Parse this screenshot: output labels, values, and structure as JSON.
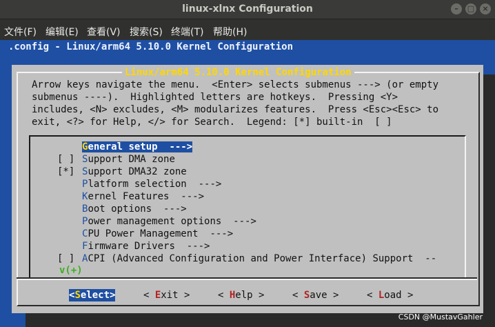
{
  "window": {
    "title": "linux-xlnx Configuration",
    "min_glyph": "–",
    "max_glyph": "□",
    "close_glyph": "×"
  },
  "menubar": [
    {
      "label": "文件(F)"
    },
    {
      "label": "编辑(E)"
    },
    {
      "label": "查看(V)"
    },
    {
      "label": "搜索(S)"
    },
    {
      "label": "终端(T)"
    },
    {
      "label": "帮助(H)"
    }
  ],
  "terminal": {
    "headline": ".config - Linux/arm64 5.10.0 Kernel Configuration"
  },
  "dialog": {
    "title": "Linux/arm64 5.10.0 Kernel Configuration",
    "help_lines": [
      "Arrow keys navigate the menu.  <Enter> selects submenus ---> (or empty",
      "submenus ----).  Highlighted letters are hotkeys.  Pressing <Y>",
      "includes, <N> excludes, <M> modularizes features.  Press <Esc><Esc> to",
      "exit, <?> for Help, </> for Search.  Legend: [*] built-in  [ ]"
    ],
    "items": [
      {
        "prefix": "",
        "hotkey": "G",
        "rest": "eneral setup  --->"
      },
      {
        "prefix": "[ ]",
        "hotkey": "S",
        "rest": "upport DMA zone"
      },
      {
        "prefix": "[*]",
        "hotkey": "S",
        "rest": "upport DMA32 zone"
      },
      {
        "prefix": "",
        "hotkey": "P",
        "rest": "latform selection  --->"
      },
      {
        "prefix": "",
        "hotkey": "K",
        "rest": "ernel Features  --->"
      },
      {
        "prefix": "",
        "hotkey": "B",
        "rest": "oot options  --->"
      },
      {
        "prefix": "",
        "hotkey": "P",
        "rest": "ower management options  --->"
      },
      {
        "prefix": "",
        "hotkey": "C",
        "rest": "PU Power Management  --->"
      },
      {
        "prefix": "",
        "hotkey": "F",
        "rest": "irmware Drivers  --->"
      },
      {
        "prefix": "[ ]",
        "hotkey": "A",
        "rest": "CPI (Advanced Configuration and Power Interface) Support  --"
      }
    ],
    "more_indicator": "v(+)",
    "buttons": [
      {
        "open": "<",
        "hotkey": "S",
        "rest": "elect",
        "close": ">"
      },
      {
        "open": "< ",
        "hotkey": "E",
        "rest": "xit",
        "close": " >"
      },
      {
        "open": "< ",
        "hotkey": "H",
        "rest": "elp",
        "close": " >"
      },
      {
        "open": "< ",
        "hotkey": "S",
        "rest": "ave",
        "close": " >"
      },
      {
        "open": "< ",
        "hotkey": "L",
        "rest": "oad",
        "close": " >"
      }
    ]
  },
  "watermark": "CSDN @MustavGahler"
}
